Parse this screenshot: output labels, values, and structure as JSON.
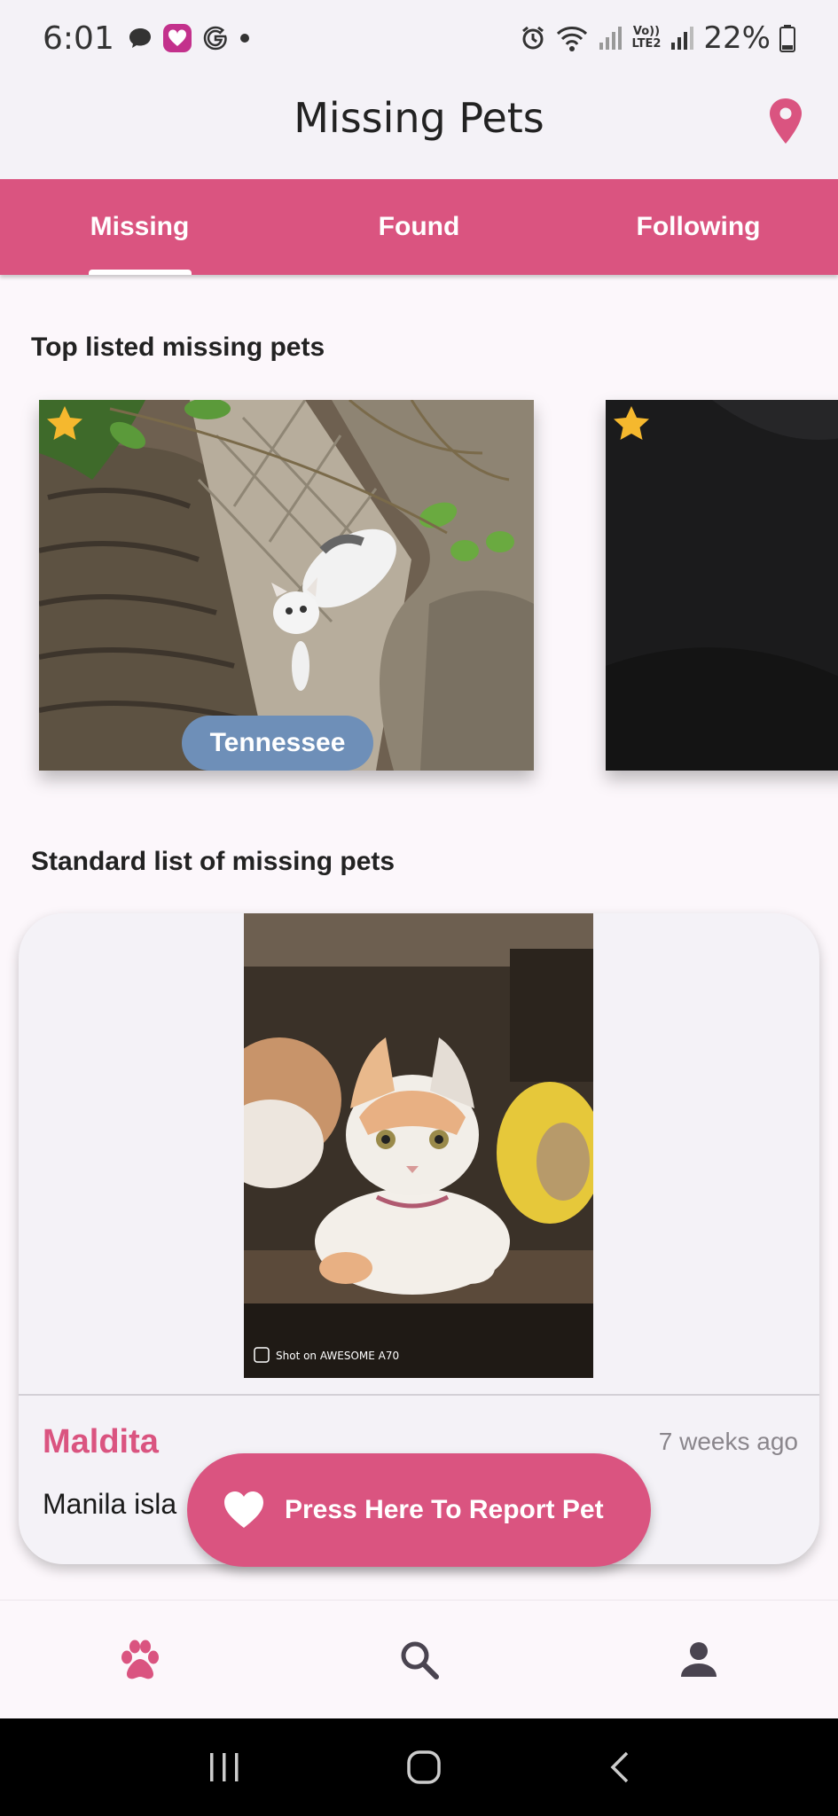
{
  "status_bar": {
    "time": "6:01",
    "battery": "22%",
    "network_label": "LTE2",
    "left_icons": [
      "chat-icon",
      "lazada-icon",
      "google-icon",
      "dot-icon"
    ],
    "right_icons": [
      "alarm-icon",
      "wifi-icon",
      "signal-icon",
      "volte-icon",
      "signal-icon",
      "battery-icon"
    ]
  },
  "app_bar": {
    "title": "Missing Pets",
    "location_icon": "location-pin-icon"
  },
  "tabs": [
    {
      "label": "Missing",
      "active": true
    },
    {
      "label": "Found",
      "active": false
    },
    {
      "label": "Following",
      "active": false
    }
  ],
  "top_section": {
    "heading": "Top listed missing pets",
    "cards": [
      {
        "location": "Tennessee",
        "starred": true,
        "image": "white cat lying on a sofa among leaves"
      },
      {
        "location": "",
        "starred": true,
        "image": "dark photo of a pet"
      }
    ]
  },
  "standard_section": {
    "heading": "Standard list of missing pets",
    "card": {
      "name": "Maldita",
      "time_ago": "7 weeks ago",
      "location": "Manila isla",
      "photo_watermark": "Shot on AWESOME A70"
    }
  },
  "report_button": {
    "label": "Press Here To Report Pet",
    "icon": "heart-icon"
  },
  "bottom_nav": [
    {
      "icon": "paw-icon",
      "active": true
    },
    {
      "icon": "search-icon",
      "active": false
    },
    {
      "icon": "profile-icon",
      "active": false
    }
  ],
  "system_nav": [
    "recent-apps-icon",
    "home-icon",
    "back-icon"
  ],
  "colors": {
    "accent": "#da5480",
    "chip": "#6e8fb8",
    "star": "#f5b82e",
    "background": "#fcf7fb"
  }
}
